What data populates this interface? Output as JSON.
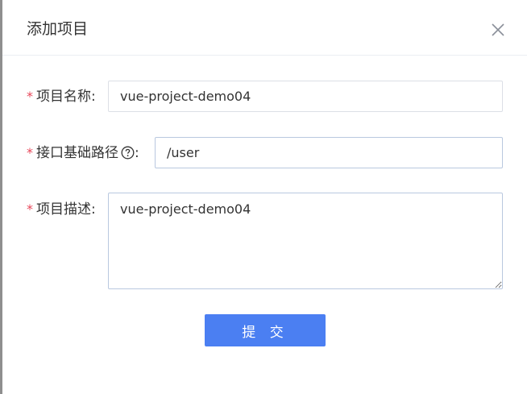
{
  "dialog": {
    "title": "添加项目",
    "close_icon": "close-icon"
  },
  "form": {
    "required_mark": "*",
    "project_name": {
      "label": "项目名称:",
      "value": "vue-project-demo04"
    },
    "base_path": {
      "label": "接口基础路径",
      "label_suffix": ":",
      "help_icon": "question-circle-icon",
      "value": "/user"
    },
    "description": {
      "label": "项目描述:",
      "value": "vue-project-demo04"
    },
    "submit_label": "提 交"
  },
  "colors": {
    "primary": "#4b7ff2",
    "required": "#e8475a",
    "border": "#dcdfe6"
  }
}
